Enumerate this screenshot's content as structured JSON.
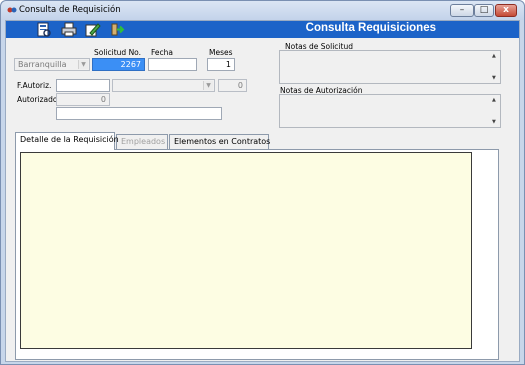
{
  "window": {
    "title": "Consulta de Requisición",
    "controls": {
      "minimize": "–",
      "maximize": "□",
      "close": "x"
    }
  },
  "toolbar": {
    "title": "Consulta Requisiciones",
    "icons": [
      "report-icon",
      "printer-icon",
      "edit-icon",
      "exit-icon"
    ],
    "color": "#1c63c8"
  },
  "form": {
    "ciudad": {
      "value": "Barranquilla"
    },
    "solicitud": {
      "label": "Solicitud No.",
      "value": "2267"
    },
    "fecha": {
      "label": "Fecha",
      "value": ""
    },
    "meses": {
      "label": "Meses",
      "value": "1"
    },
    "fautoriz": {
      "label": "F.Autoriz.",
      "value": ""
    },
    "autoriz_combo": {
      "value": ""
    },
    "autoriz_num": {
      "value": "0"
    },
    "autorizado": {
      "label": "Autorizado",
      "value": "0"
    },
    "autorizado_nombre": {
      "value": ""
    }
  },
  "notas": {
    "solicitud_label": "Notas de Solicitud",
    "autorizacion_label": "Notas de Autorización"
  },
  "tabs": [
    {
      "label": "Detalle de la Requisición",
      "active": true,
      "enabled": true
    },
    {
      "label": "Empleados",
      "active": false,
      "enabled": false
    },
    {
      "label": "Elementos en Contratos",
      "active": false,
      "enabled": true
    }
  ]
}
